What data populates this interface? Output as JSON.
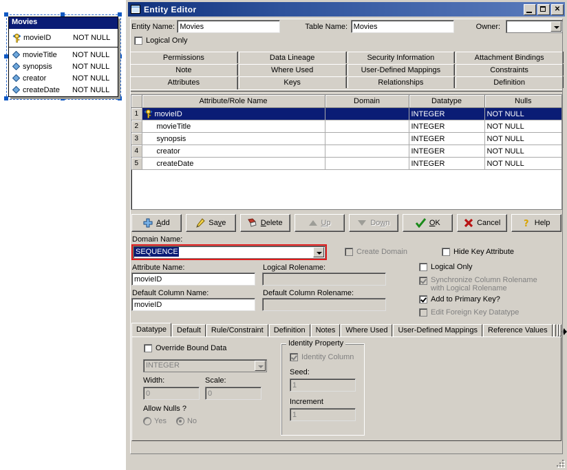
{
  "diagram": {
    "entity": {
      "title": "Movies",
      "primary_key": {
        "name": "movieID",
        "nulls": "NOT NULL",
        "icon": "key-icon"
      },
      "attributes": [
        {
          "name": "movieTitle",
          "nulls": "NOT NULL",
          "icon": "diamond-icon"
        },
        {
          "name": "synopsis",
          "nulls": "NOT NULL",
          "icon": "diamond-icon"
        },
        {
          "name": "creator",
          "nulls": "NOT NULL",
          "icon": "diamond-icon"
        },
        {
          "name": "createDate",
          "nulls": "NOT NULL",
          "icon": "diamond-icon"
        }
      ]
    }
  },
  "dialog": {
    "title": "Entity Editor",
    "window_buttons": {
      "minimize": "minimize-icon",
      "maximize": "maximize-icon",
      "close": "close-icon"
    },
    "header": {
      "entity_name_label": "Entity Name:",
      "entity_name_value": "Movies",
      "table_name_label": "Table Name:",
      "table_name_value": "Movies",
      "owner_label": "Owner:",
      "owner_value": "",
      "logical_only_label": "Logical Only",
      "logical_only_checked": false
    },
    "tab_rows": [
      [
        "Permissions",
        "Data Lineage",
        "Security Information",
        "Attachment Bindings"
      ],
      [
        "Note",
        "Where Used",
        "User-Defined Mappings",
        "Constraints"
      ],
      [
        "Attributes",
        "Keys",
        "Relationships",
        "Definition"
      ]
    ],
    "active_tab": "Attributes",
    "grid": {
      "columns": [
        "",
        "Attribute/Role Name",
        "Domain",
        "Datatype",
        "Nulls"
      ],
      "rows": [
        {
          "num": "1",
          "name": "movieID",
          "domain": "",
          "datatype": "INTEGER",
          "nulls": "NOT NULL",
          "icon": "key-icon",
          "selected": true
        },
        {
          "num": "2",
          "name": "movieTitle",
          "domain": "",
          "datatype": "INTEGER",
          "nulls": "NOT NULL",
          "icon": "",
          "selected": false
        },
        {
          "num": "3",
          "name": "synopsis",
          "domain": "",
          "datatype": "INTEGER",
          "nulls": "NOT NULL",
          "icon": "",
          "selected": false
        },
        {
          "num": "4",
          "name": "creator",
          "domain": "",
          "datatype": "INTEGER",
          "nulls": "NOT NULL",
          "icon": "",
          "selected": false
        },
        {
          "num": "5",
          "name": "createDate",
          "domain": "",
          "datatype": "INTEGER",
          "nulls": "NOT NULL",
          "icon": "",
          "selected": false
        }
      ]
    },
    "buttons": [
      {
        "label": "Add",
        "accel": "A",
        "icon": "plus-icon",
        "enabled": true
      },
      {
        "label": "Save",
        "accel": "v",
        "icon": "pencil-icon",
        "enabled": true
      },
      {
        "label": "Delete",
        "accel": "D",
        "icon": "eraser-icon",
        "enabled": true
      },
      {
        "label": "Up",
        "accel": "U",
        "icon": "up-arrow-icon",
        "enabled": false
      },
      {
        "label": "Down",
        "accel": "w",
        "icon": "down-arrow-icon",
        "enabled": false
      },
      {
        "label": "OK",
        "accel": "O",
        "icon": "check-icon",
        "enabled": true
      },
      {
        "label": "Cancel",
        "accel": "",
        "icon": "x-icon",
        "enabled": true
      },
      {
        "label": "Help",
        "accel": "",
        "icon": "question-icon",
        "enabled": true
      }
    ],
    "properties": {
      "domain_name_label": "Domain Name:",
      "domain_name_value": "SEQUENCE",
      "create_domain_label": "Create Domain",
      "create_domain_checked": false,
      "create_domain_enabled": false,
      "attribute_name_label": "Attribute Name:",
      "attribute_name_value": "movieID",
      "logical_rolename_label": "Logical Rolename:",
      "logical_rolename_value": "",
      "default_column_name_label": "Default Column Name:",
      "default_column_name_value": "movieID",
      "default_column_rolename_label": "Default Column Rolename:",
      "default_column_rolename_value": "",
      "checkboxes": [
        {
          "label": "Hide Key Attribute",
          "checked": false,
          "enabled": true
        },
        {
          "label": "Logical Only",
          "checked": false,
          "enabled": true
        },
        {
          "label": "Synchronize Column Rolename",
          "label2": "with Logical Rolename",
          "checked": true,
          "enabled": false
        },
        {
          "label": "Add to Primary Key?",
          "checked": true,
          "enabled": true
        },
        {
          "label": "Edit Foreign Key Datatype",
          "checked": false,
          "enabled": false
        }
      ]
    },
    "bottom_tabs": [
      "Datatype",
      "Default",
      "Rule/Constraint",
      "Definition",
      "Notes",
      "Where Used",
      "User-Defined Mappings",
      "Reference Values",
      "D"
    ],
    "bottom_active_tab": "Datatype",
    "tab_scroll": {
      "left": "left-arrow-icon",
      "right": "right-arrow-icon",
      "left_enabled": false,
      "right_enabled": true
    },
    "datatype_panel": {
      "override_bound_data_label": "Override Bound Data",
      "override_bound_data_checked": false,
      "datatype_value": "INTEGER",
      "width_label": "Width:",
      "width_value": "0",
      "scale_label": "Scale:",
      "scale_value": "0",
      "allow_nulls_label": "Allow Nulls ?",
      "allow_nulls_yes": "Yes",
      "allow_nulls_no": "No",
      "allow_nulls_selected": "No",
      "identity_group_label": "Identity Property",
      "identity_column_label": "Identity Column",
      "identity_column_checked": true,
      "seed_label": "Seed:",
      "seed_value": "1",
      "increment_label": "Increment",
      "increment_value": "1"
    }
  },
  "colors": {
    "dialog_face": "#d4d0c8",
    "title_dark": "#10317c",
    "title_light": "#5b7cbd",
    "selection": "#0a1c75",
    "focus_red": "#e01b1b",
    "key_yellow": "#f2c830",
    "diamond_blue": "#6fa8dc"
  }
}
